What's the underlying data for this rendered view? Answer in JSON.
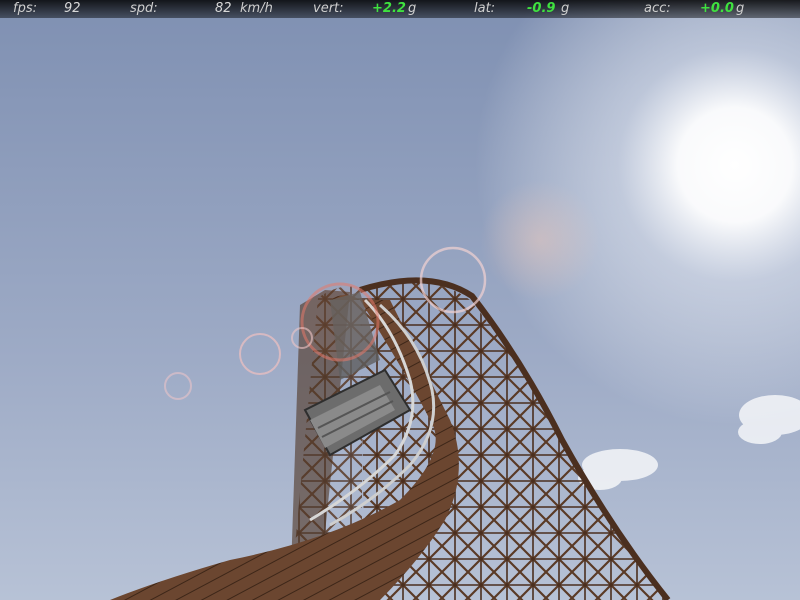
{
  "hud": {
    "fps_label": "fps:",
    "fps_value": "92",
    "spd_label": "spd:",
    "spd_value": "82",
    "spd_unit": "km/h",
    "vert_label": "vert:",
    "vert_value": "+2.2",
    "vert_unit": "g",
    "lat_label": "lat:",
    "lat_value": "-0.9",
    "lat_unit": "g",
    "acc_label": "acc:",
    "acc_value": "+0.0",
    "acc_unit": "g"
  },
  "colors": {
    "sky_top": "#7a8cae",
    "sky_bottom": "#b3bed2",
    "wood": "#5a3a26",
    "g_value": "#3fe23f"
  }
}
